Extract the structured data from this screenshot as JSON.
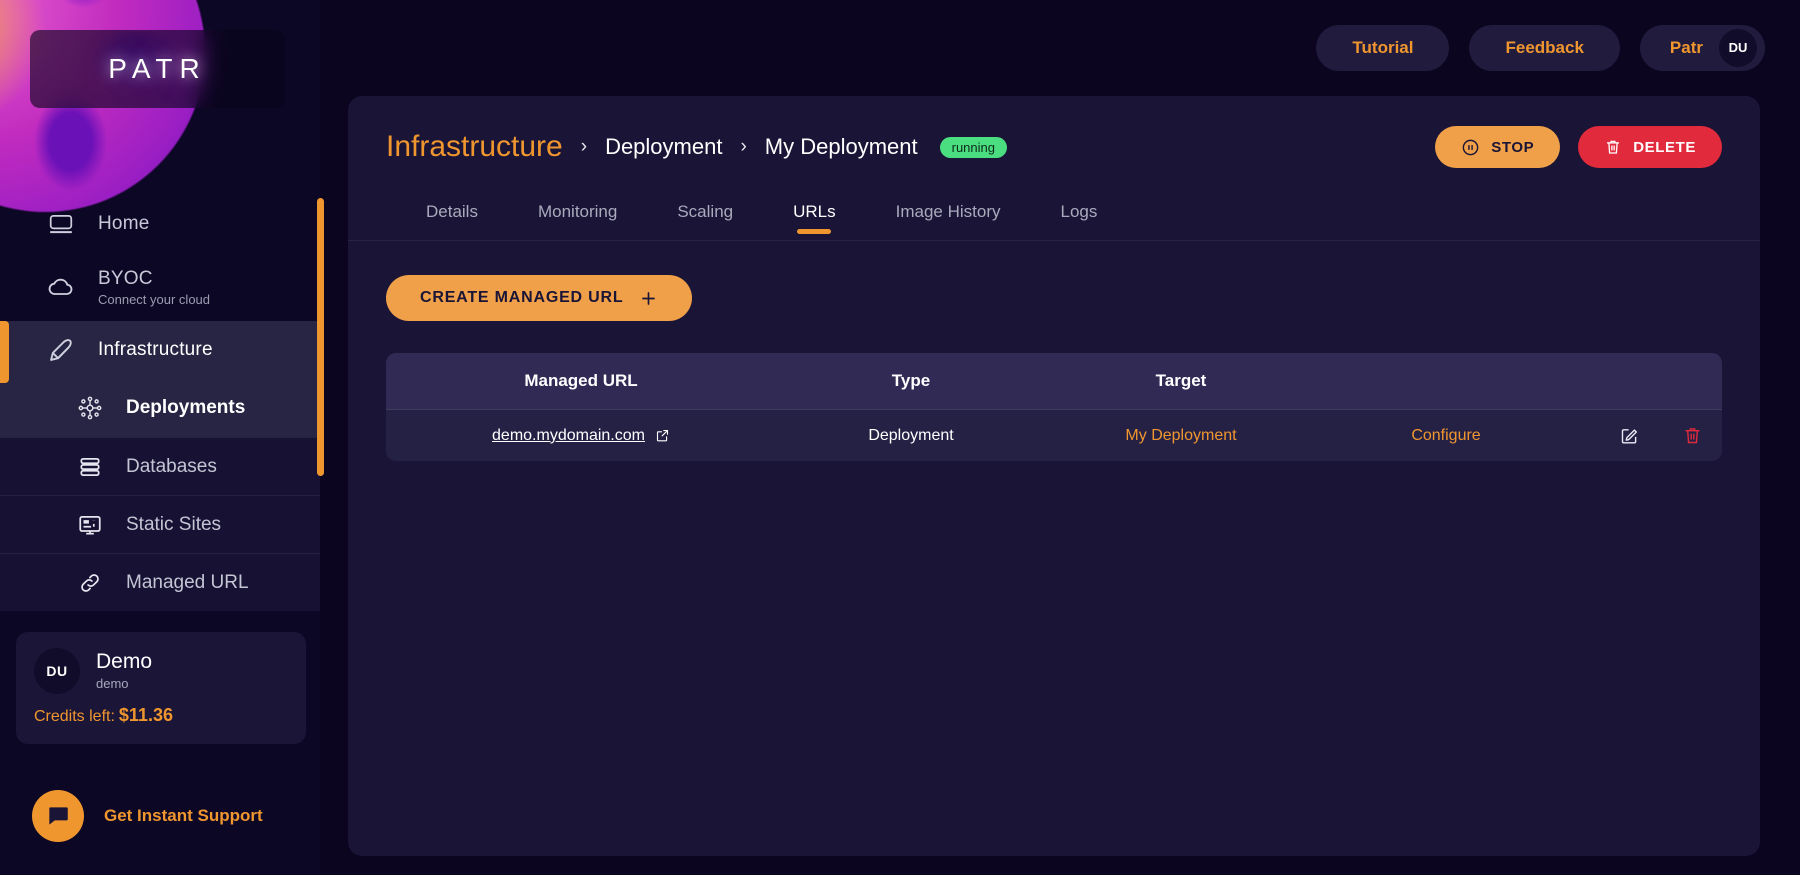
{
  "brand": {
    "logo_text": "PATR"
  },
  "sidebar": {
    "items": [
      {
        "label": "Home",
        "icon": "monitor-icon"
      },
      {
        "label": "BYOC",
        "sublabel": "Connect your cloud",
        "icon": "cloud-icon"
      },
      {
        "label": "Infrastructure",
        "icon": "rocket-icon"
      }
    ],
    "sub_items": [
      {
        "label": "Deployments",
        "icon": "deployments-icon"
      },
      {
        "label": "Databases",
        "icon": "database-icon"
      },
      {
        "label": "Static Sites",
        "icon": "static-site-icon"
      },
      {
        "label": "Managed URL",
        "icon": "link-icon"
      }
    ],
    "profile": {
      "initials": "DU",
      "name": "Demo",
      "handle": "demo",
      "credits_label": "Credits left:",
      "credits_value": "$11.36"
    },
    "support": {
      "label": "Get Instant Support",
      "icon": "chat-icon"
    }
  },
  "topbar": {
    "tutorial": "Tutorial",
    "feedback": "Feedback",
    "workspace": "Patr",
    "avatar_initials": "DU"
  },
  "panel": {
    "breadcrumb": {
      "root": "Infrastructure",
      "separator": "›",
      "middle": "Deployment",
      "current": "My Deployment",
      "status_badge": "running"
    },
    "actions": {
      "stop": "STOP",
      "delete": "DELETE"
    },
    "tabs": [
      {
        "label": "Details",
        "active": false
      },
      {
        "label": "Monitoring",
        "active": false
      },
      {
        "label": "Scaling",
        "active": false
      },
      {
        "label": "URLs",
        "active": true
      },
      {
        "label": "Image History",
        "active": false
      },
      {
        "label": "Logs",
        "active": false
      }
    ],
    "create_button": "CREATE MANAGED URL",
    "table": {
      "headers": [
        "Managed URL",
        "Type",
        "Target",
        "",
        ""
      ],
      "rows": [
        {
          "url": "demo.mydomain.com",
          "type": "Deployment",
          "target": "My Deployment",
          "configure": "Configure",
          "edit_icon": "edit-icon",
          "delete_icon": "trash-icon"
        }
      ]
    }
  },
  "colors": {
    "accent": "#f0962f",
    "danger": "#e12b3c",
    "success": "#4ade80",
    "panel_bg": "#1a1436",
    "page_bg": "#0b0520",
    "sidebar_bg": "#0d0726"
  }
}
